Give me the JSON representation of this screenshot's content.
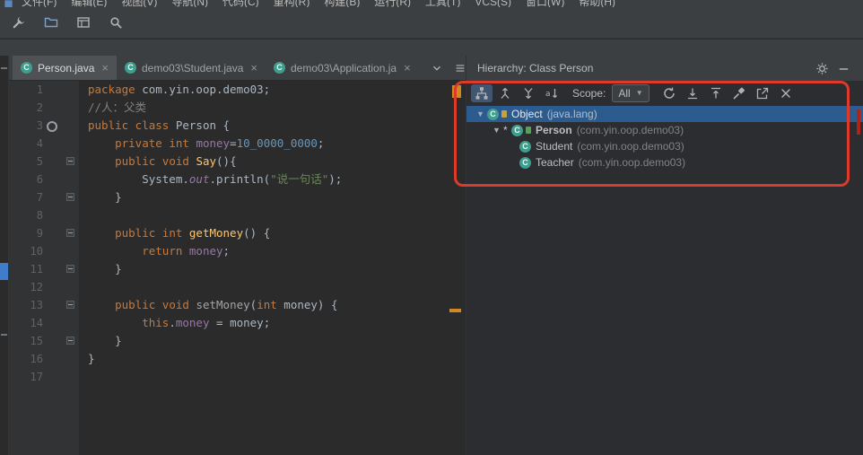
{
  "menu": {
    "items": [
      "文件(F)",
      "编辑(E)",
      "视图(V)",
      "导航(N)",
      "代码(C)",
      "重构(R)",
      "构建(B)",
      "运行(R)",
      "工具(T)",
      "VCS(S)",
      "窗口(W)",
      "帮助(H)"
    ]
  },
  "main_toolbar": {
    "icons": [
      "wrench-icon",
      "folder-icon",
      "layout-icon",
      "search-icon"
    ]
  },
  "tabs": {
    "close_glyph": "×",
    "items": [
      {
        "label": "Person.java",
        "selected": true
      },
      {
        "label": "demo03\\Student.java",
        "selected": false
      },
      {
        "label": "demo03\\Application.ja",
        "selected": false
      }
    ],
    "strip_icons": [
      "chevron-down-icon",
      "list-icon"
    ]
  },
  "hierarchy": {
    "title": "Hierarchy: Class Person",
    "scope_label": "Scope:",
    "scope_value": "All",
    "toolbar_left_icons": [
      {
        "name": "class-hierarchy-icon",
        "selected": true
      },
      {
        "name": "supertypes-hierarchy-icon",
        "selected": false
      },
      {
        "name": "subtypes-hierarchy-icon",
        "selected": false
      },
      {
        "name": "sort-alphabetically-icon",
        "selected": false
      }
    ],
    "toolbar_right_icons": [
      "refresh-icon",
      "expand-all-icon",
      "collapse-all-icon",
      "pin-icon",
      "open-in-new-window-icon",
      "close-icon"
    ],
    "tree": [
      {
        "name": "Object",
        "package": "(java.lang)",
        "depth": 0,
        "expanded": true,
        "selected": true,
        "badge": true,
        "star": false,
        "bold": false
      },
      {
        "name": "Person",
        "package": "(com.yin.oop.demo03)",
        "depth": 1,
        "expanded": true,
        "selected": false,
        "badge": true,
        "star": true,
        "bold": true
      },
      {
        "name": "Student",
        "package": "(com.yin.oop.demo03)",
        "depth": 2,
        "expanded": false,
        "selected": false,
        "badge": false,
        "star": false,
        "bold": false
      },
      {
        "name": "Teacher",
        "package": "(com.yin.oop.demo03)",
        "depth": 2,
        "expanded": false,
        "selected": false,
        "badge": false,
        "star": false,
        "bold": false
      }
    ]
  },
  "editor": {
    "class_icon_line": 3,
    "fold_lines": [
      5,
      7,
      9,
      11,
      13,
      15
    ],
    "lines": [
      {
        "n": 1,
        "tokens": [
          [
            "kw",
            "package"
          ],
          [
            "pln",
            " com.yin.oop.demo03;"
          ]
        ]
      },
      {
        "n": 2,
        "tokens": [
          [
            "cmt",
            "//人：父类"
          ]
        ]
      },
      {
        "n": 3,
        "tokens": [
          [
            "kw",
            "public class"
          ],
          [
            "pln",
            " Person {"
          ]
        ]
      },
      {
        "n": 4,
        "tokens": [
          [
            "pln",
            "    "
          ],
          [
            "kw",
            "private int"
          ],
          [
            "pln",
            " "
          ],
          [
            "fld",
            "money"
          ],
          [
            "pln",
            "="
          ],
          [
            "num",
            "10_0000_0000"
          ],
          [
            "pln",
            ";"
          ]
        ]
      },
      {
        "n": 5,
        "tokens": [
          [
            "pln",
            "    "
          ],
          [
            "kw",
            "public void"
          ],
          [
            "pln",
            " "
          ],
          [
            "mth",
            "Say"
          ],
          [
            "pln",
            "(){"
          ]
        ]
      },
      {
        "n": 6,
        "tokens": [
          [
            "pln",
            "        System."
          ],
          [
            "sfld",
            "out"
          ],
          [
            "pln",
            ".println("
          ],
          [
            "str",
            "\"说一句话\""
          ],
          [
            "pln",
            ");"
          ]
        ]
      },
      {
        "n": 7,
        "tokens": [
          [
            "pln",
            "    }"
          ]
        ]
      },
      {
        "n": 8,
        "tokens": []
      },
      {
        "n": 9,
        "tokens": [
          [
            "pln",
            "    "
          ],
          [
            "kw",
            "public int"
          ],
          [
            "pln",
            " "
          ],
          [
            "mth",
            "getMoney"
          ],
          [
            "pln",
            "() {"
          ]
        ]
      },
      {
        "n": 10,
        "tokens": [
          [
            "pln",
            "        "
          ],
          [
            "kw",
            "return"
          ],
          [
            "pln",
            " "
          ],
          [
            "fld",
            "money"
          ],
          [
            "pln",
            ";"
          ]
        ]
      },
      {
        "n": 11,
        "tokens": [
          [
            "pln",
            "    }"
          ]
        ]
      },
      {
        "n": 12,
        "tokens": []
      },
      {
        "n": 13,
        "tokens": [
          [
            "pln",
            "    "
          ],
          [
            "kw",
            "public void"
          ],
          [
            "pln",
            " "
          ],
          [
            "dim",
            "setMoney"
          ],
          [
            "pln",
            "("
          ],
          [
            "kw",
            "int"
          ],
          [
            "pln",
            " money) {"
          ]
        ]
      },
      {
        "n": 14,
        "tokens": [
          [
            "pln",
            "        "
          ],
          [
            "kw",
            "this"
          ],
          [
            "pln",
            "."
          ],
          [
            "fld",
            "money"
          ],
          [
            "pln",
            " = money;"
          ]
        ]
      },
      {
        "n": 15,
        "tokens": [
          [
            "pln",
            "    }"
          ]
        ]
      },
      {
        "n": 16,
        "tokens": [
          [
            "pln",
            "}"
          ]
        ]
      },
      {
        "n": 17,
        "tokens": []
      }
    ]
  },
  "colors": {
    "ui_background": "#3c3f41",
    "editor_background": "#2b2b2b",
    "selection_blue": "#2c5c8f",
    "annotation_red": "#dc3a2a",
    "keyword": "#cc7832",
    "plain": "#a9b7c6",
    "comment": "#808080",
    "field": "#9876aa",
    "number": "#6897bb",
    "string": "#6a8759",
    "method": "#ffc66b",
    "class_icon_teal": "#3f9e8d",
    "warning_stripe_orange": "#cf8a1e"
  }
}
